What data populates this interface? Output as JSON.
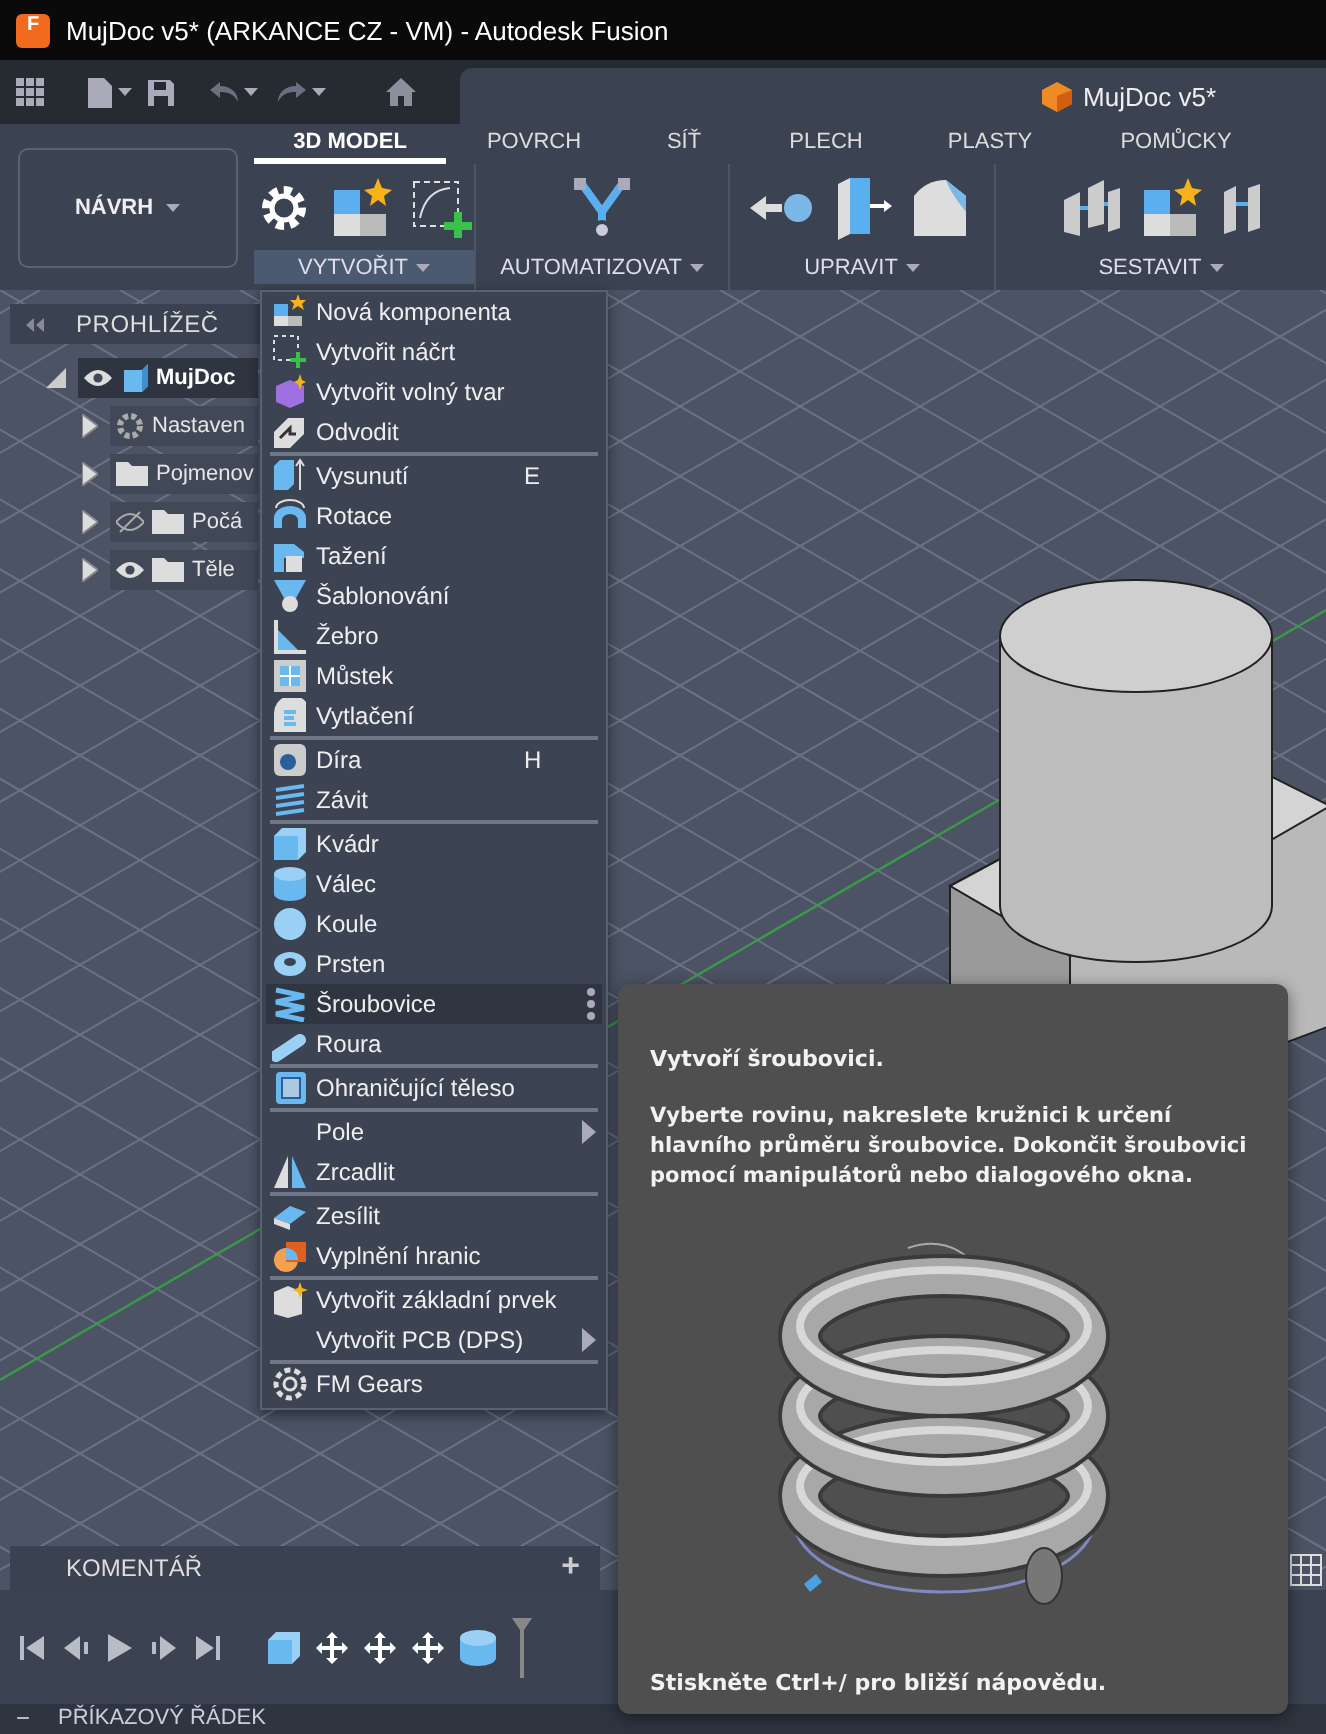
{
  "window": {
    "app_logo": "F",
    "title": "MujDoc v5* (ARKANCE CZ - VM) - Autodesk Fusion"
  },
  "document_tab": {
    "label": "MujDoc v5*"
  },
  "ribbon": {
    "workspace": "NÁVRH",
    "tabs": [
      {
        "label": "3D MODEL",
        "selected": true
      },
      {
        "label": "POVRCH",
        "selected": false
      },
      {
        "label": "SÍŤ",
        "selected": false
      },
      {
        "label": "PLECH",
        "selected": false
      },
      {
        "label": "PLASTY",
        "selected": false
      },
      {
        "label": "POMŮCKY",
        "selected": false
      }
    ],
    "groups": [
      {
        "label": "VYTVOŘIT",
        "expanded": true
      },
      {
        "label": "AUTOMATIZOVAT",
        "expanded": false
      },
      {
        "label": "UPRAVIT",
        "expanded": false
      },
      {
        "label": "SESTAVIT",
        "expanded": false
      }
    ]
  },
  "browser": {
    "title": "PROHLÍŽEČ",
    "tree": [
      {
        "label": "MujDoc",
        "kind": "document",
        "visible": true,
        "expanded": true,
        "children": [
          {
            "label": "Nastaven",
            "kind": "settings",
            "expanded": false
          },
          {
            "label": "Pojmenov",
            "kind": "folder",
            "expanded": false
          },
          {
            "label": "Počá",
            "kind": "folder",
            "visible": false,
            "expanded": false
          },
          {
            "label": "Těle",
            "kind": "folder",
            "visible": true,
            "expanded": false
          }
        ]
      }
    ]
  },
  "create_menu": {
    "groups": [
      [
        {
          "label": "Nová komponenta",
          "kind": "command",
          "selected": false
        },
        {
          "label": "Vytvořit náčrt",
          "kind": "command",
          "selected": false
        },
        {
          "label": "Vytvořit volný tvar",
          "kind": "command",
          "selected": false
        },
        {
          "label": "Odvodit",
          "kind": "command",
          "selected": false
        }
      ],
      [
        {
          "label": "Vysunutí",
          "shortcut": "E",
          "kind": "command",
          "selected": false
        },
        {
          "label": "Rotace",
          "kind": "command",
          "selected": false
        },
        {
          "label": "Tažení",
          "kind": "command",
          "selected": false
        },
        {
          "label": "Šablonování",
          "kind": "command",
          "selected": false
        },
        {
          "label": "Žebro",
          "kind": "command",
          "selected": false
        },
        {
          "label": "Můstek",
          "kind": "command",
          "selected": false
        },
        {
          "label": "Vytlačení",
          "kind": "command",
          "selected": false
        }
      ],
      [
        {
          "label": "Díra",
          "shortcut": "H",
          "kind": "command",
          "selected": false
        },
        {
          "label": "Závit",
          "kind": "command",
          "selected": false
        }
      ],
      [
        {
          "label": "Kvádr",
          "kind": "command",
          "selected": false
        },
        {
          "label": "Válec",
          "kind": "command",
          "selected": false
        },
        {
          "label": "Koule",
          "kind": "command",
          "selected": false
        },
        {
          "label": "Prsten",
          "kind": "command",
          "selected": false
        },
        {
          "label": "Šroubovice",
          "kind": "command",
          "selected": true
        },
        {
          "label": "Roura",
          "kind": "command",
          "selected": false
        }
      ],
      [
        {
          "label": "Ohraničující těleso",
          "kind": "command",
          "selected": false
        }
      ],
      [
        {
          "label": "Pole",
          "kind": "submenu",
          "selected": false
        },
        {
          "label": "Zrcadlit",
          "kind": "command",
          "selected": false
        }
      ],
      [
        {
          "label": "Zesílit",
          "kind": "command",
          "selected": false
        },
        {
          "label": "Vyplnění hranic",
          "kind": "command",
          "selected": false
        }
      ],
      [
        {
          "label": "Vytvořit základní prvek",
          "kind": "command",
          "selected": false
        },
        {
          "label": "Vytvořit PCB (DPS)",
          "kind": "submenu",
          "selected": false
        }
      ],
      [
        {
          "label": "FM Gears",
          "kind": "command",
          "selected": false
        }
      ]
    ]
  },
  "tooltip": {
    "title": "Vytvoří šroubovici.",
    "description": "Vyberte rovinu, nakreslete kružnici k určení hlavního průměru šroubovice. Dokončit šroubovici pomocí manipulátorů nebo dialogového okna.",
    "footer": "Stiskněte Ctrl+/ pro bližší nápovědu."
  },
  "comments": {
    "title": "KOMENTÁŘ",
    "add": "+"
  },
  "command_line": {
    "toggle": "−",
    "title": "PŘÍKAZOVÝ ŘÁDEK"
  }
}
